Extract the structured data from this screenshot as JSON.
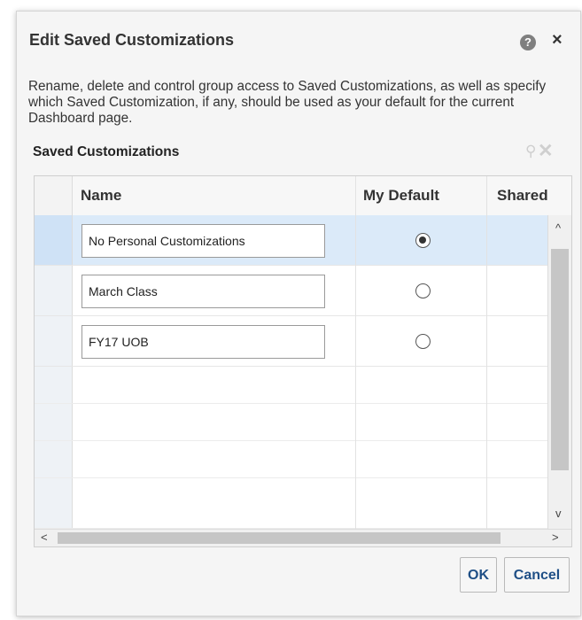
{
  "dialog": {
    "title": "Edit Saved Customizations",
    "help_icon": "?",
    "close_icon": "×",
    "description": "Rename, delete and control group access to Saved Customizations, as well as specify which Saved Customization, if any, should be used as your default for the current Dashboard page."
  },
  "section": {
    "title": "Saved Customizations",
    "toolbar": {
      "key_icon": "⚲",
      "delete_icon": "✕"
    }
  },
  "table": {
    "columns": [
      "Name",
      "My Default",
      "Shared"
    ],
    "rows": [
      {
        "name": "No Personal Customizations",
        "default": true,
        "selected": true
      },
      {
        "name": "March Class",
        "default": false,
        "selected": false
      },
      {
        "name": "FY17 UOB",
        "default": false,
        "selected": false
      }
    ],
    "scroll": {
      "up": "^",
      "down": "v",
      "left": "<",
      "right": ">"
    }
  },
  "buttons": {
    "ok": "OK",
    "cancel": "Cancel"
  },
  "colors": {
    "selected_row": "#dbeaf9",
    "button_text": "#1f4f86"
  }
}
